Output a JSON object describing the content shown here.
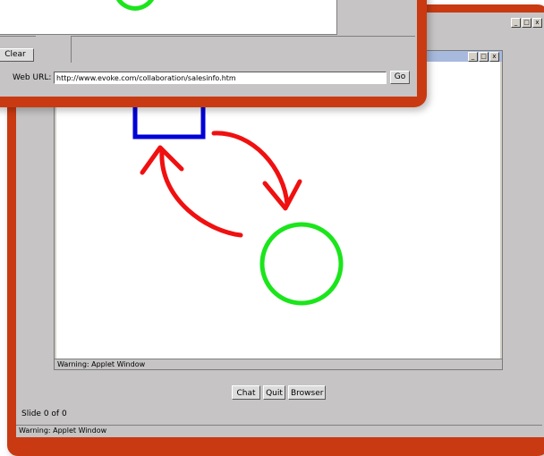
{
  "back_window": {
    "title_buttons": [
      "_",
      "□",
      "x"
    ],
    "inner_window": {
      "title_buttons": [
        "_",
        "□",
        "x"
      ],
      "status": "Warning: Applet Window"
    },
    "buttons": {
      "chat": "Chat",
      "quit": "Quit",
      "browser": "Browser"
    },
    "slide_label": "Slide 0 of 0",
    "status": "Warning: Applet Window"
  },
  "front_window": {
    "clear_button": "Clear",
    "web_url_label": "Web URL:",
    "web_url_value": "http://www.evoke.com/collaboration/salesinfo.htm",
    "go_button": "Go"
  },
  "colors": {
    "frame": "#c93a12",
    "square": "#0000d8",
    "circle": "#1be51b",
    "arrows": "#f01010"
  }
}
